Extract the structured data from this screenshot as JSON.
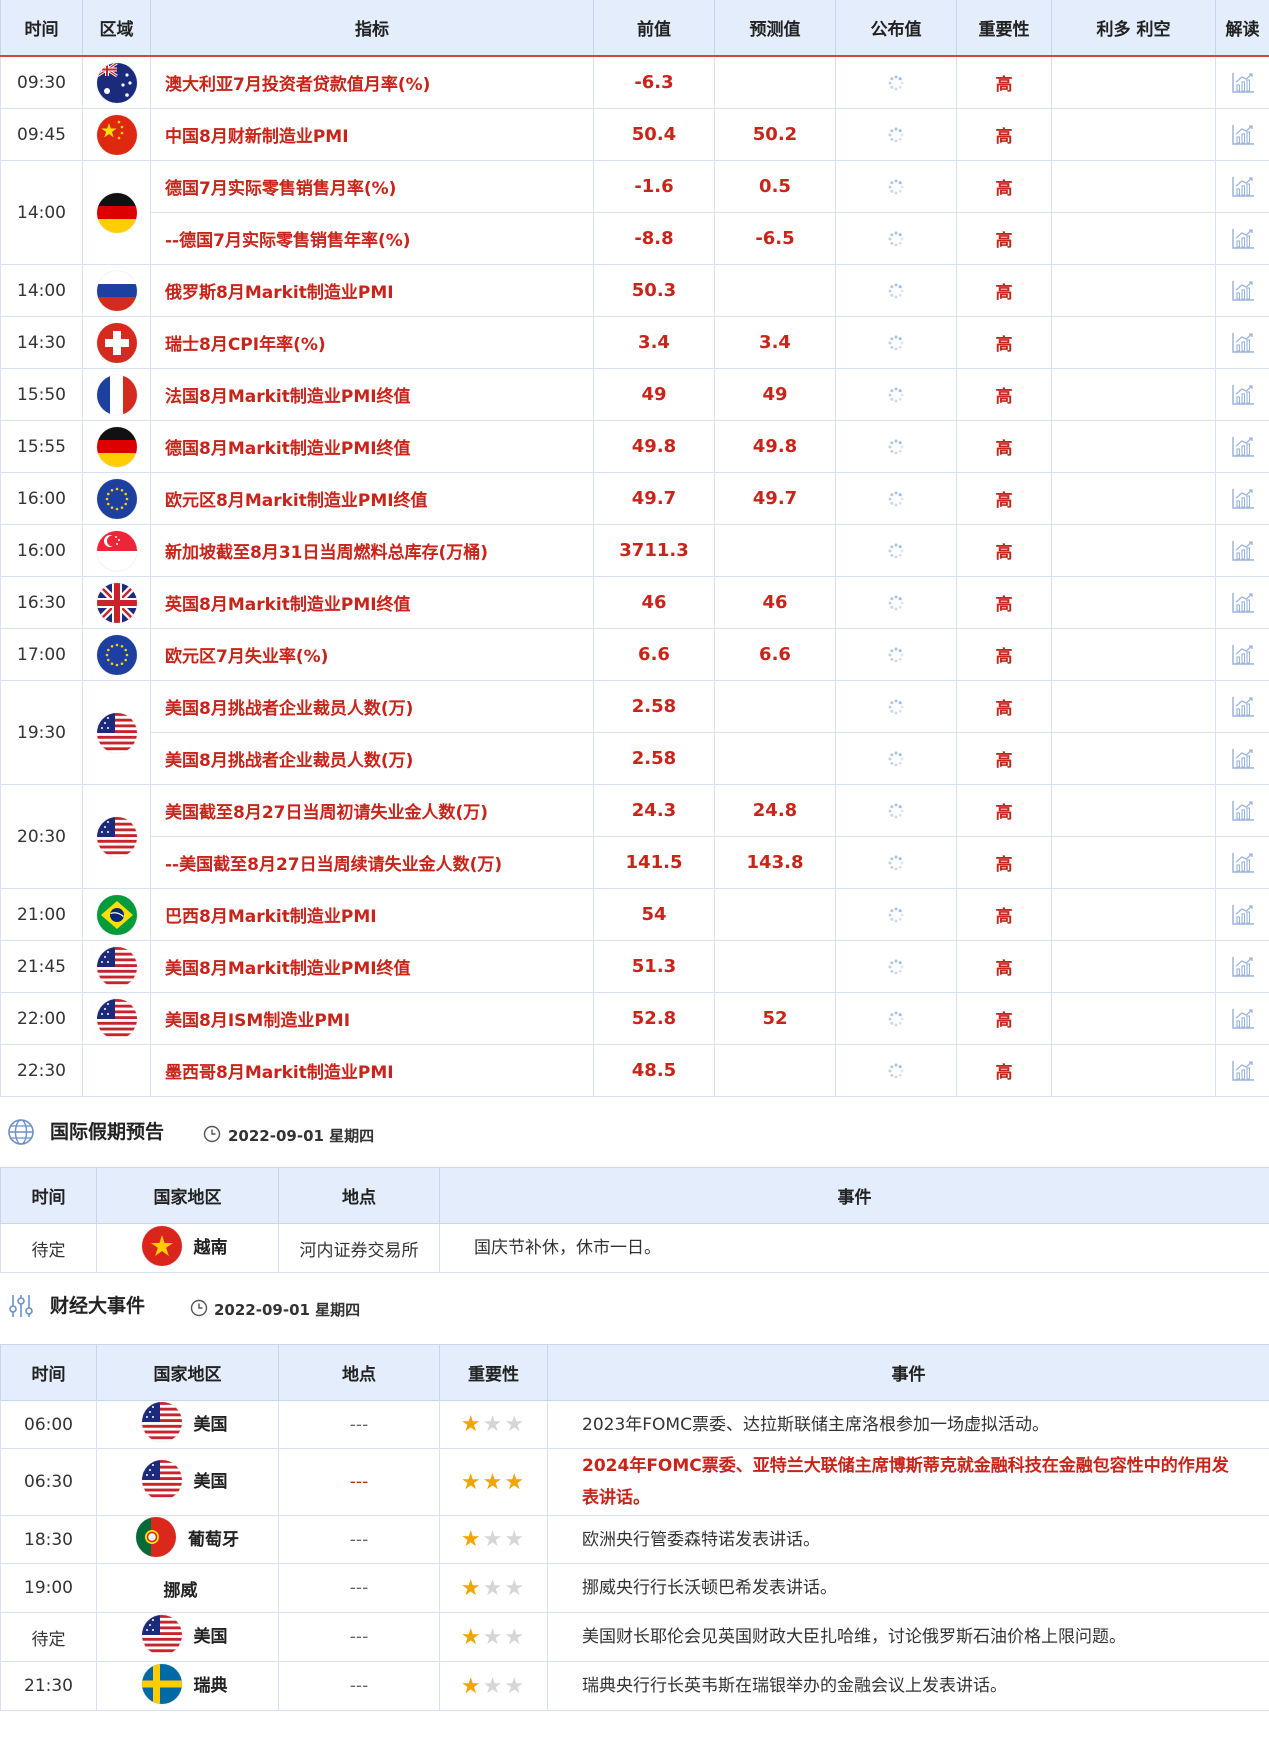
{
  "econ_table": {
    "headers": [
      "时间",
      "区域",
      "指标",
      "前值",
      "预测值",
      "公布值",
      "重要性",
      "利多 利空",
      "解读"
    ],
    "rows": [
      {
        "time": "09:30",
        "flag": "au",
        "name": "澳大利亚7月投资者贷款值月率(%)",
        "prev": "-6.3",
        "forecast": "",
        "imp": "高"
      },
      {
        "time": "09:45",
        "flag": "cn",
        "name": "中国8月财新制造业PMI",
        "prev": "50.4",
        "forecast": "50.2",
        "imp": "高"
      },
      {
        "time": "14:00",
        "flag": "de",
        "rowspan": 2,
        "name": "德国7月实际零售销售月率(%)",
        "prev": "-1.6",
        "forecast": "0.5",
        "imp": "高"
      },
      {
        "time": "",
        "flag": "",
        "name": "--德国7月实际零售销售年率(%)",
        "prev": "-8.8",
        "forecast": "-6.5",
        "imp": "高",
        "cont": true
      },
      {
        "time": "14:00",
        "flag": "ru",
        "name": "俄罗斯8月Markit制造业PMI",
        "prev": "50.3",
        "forecast": "",
        "imp": "高"
      },
      {
        "time": "14:30",
        "flag": "ch",
        "name": "瑞士8月CPI年率(%)",
        "prev": "3.4",
        "forecast": "3.4",
        "imp": "高"
      },
      {
        "time": "15:50",
        "flag": "fr",
        "name": "法国8月Markit制造业PMI终值",
        "prev": "49",
        "forecast": "49",
        "imp": "高"
      },
      {
        "time": "15:55",
        "flag": "de",
        "name": "德国8月Markit制造业PMI终值",
        "prev": "49.8",
        "forecast": "49.8",
        "imp": "高"
      },
      {
        "time": "16:00",
        "flag": "eu",
        "name": "欧元区8月Markit制造业PMI终值",
        "prev": "49.7",
        "forecast": "49.7",
        "imp": "高"
      },
      {
        "time": "16:00",
        "flag": "sg",
        "name": "新加坡截至8月31日当周燃料总库存(万桶)",
        "prev": "3711.3",
        "forecast": "",
        "imp": "高"
      },
      {
        "time": "16:30",
        "flag": "gb",
        "name": "英国8月Markit制造业PMI终值",
        "prev": "46",
        "forecast": "46",
        "imp": "高"
      },
      {
        "time": "17:00",
        "flag": "eu",
        "name": "欧元区7月失业率(%)",
        "prev": "6.6",
        "forecast": "6.6",
        "imp": "高"
      },
      {
        "time": "19:30",
        "flag": "us",
        "rowspan": 2,
        "name": "美国8月挑战者企业裁员人数(万)",
        "prev": "2.58",
        "forecast": "",
        "imp": "高"
      },
      {
        "time": "",
        "flag": "",
        "name": "美国8月挑战者企业裁员人数(万)",
        "prev": "2.58",
        "forecast": "",
        "imp": "高",
        "cont": true
      },
      {
        "time": "20:30",
        "flag": "us",
        "rowspan": 2,
        "name": "美国截至8月27日当周初请失业金人数(万)",
        "prev": "24.3",
        "forecast": "24.8",
        "imp": "高"
      },
      {
        "time": "",
        "flag": "",
        "name": "--美国截至8月27日当周续请失业金人数(万)",
        "prev": "141.5",
        "forecast": "143.8",
        "imp": "高",
        "cont": true
      },
      {
        "time": "21:00",
        "flag": "br",
        "name": "巴西8月Markit制造业PMI",
        "prev": "54",
        "forecast": "",
        "imp": "高"
      },
      {
        "time": "21:45",
        "flag": "us",
        "name": "美国8月Markit制造业PMI终值",
        "prev": "51.3",
        "forecast": "",
        "imp": "高"
      },
      {
        "time": "22:00",
        "flag": "us",
        "name": "美国8月ISM制造业PMI",
        "prev": "52.8",
        "forecast": "52",
        "imp": "高"
      },
      {
        "time": "22:30",
        "flag": "none",
        "name": "墨西哥8月Markit制造业PMI",
        "prev": "48.5",
        "forecast": "",
        "imp": "高"
      }
    ]
  },
  "holiday_section": {
    "title": "国际假期预告",
    "date": "2022-09-01 星期四",
    "headers": [
      "时间",
      "国家地区",
      "地点",
      "事件"
    ],
    "rows": [
      {
        "time": "待定",
        "flag": "vn",
        "country": "越南",
        "place": "河内证券交易所",
        "event": "国庆节补休，休市一日。"
      }
    ]
  },
  "events_section": {
    "title": "财经大事件",
    "date": "2022-09-01 星期四",
    "headers": [
      "时间",
      "国家地区",
      "地点",
      "重要性",
      "事件"
    ],
    "rows": [
      {
        "time": "06:00",
        "flag": "us",
        "country": "美国",
        "place": "---",
        "stars": 1,
        "event": "2023年FOMC票委、达拉斯联储主席洛根参加一场虚拟活动。",
        "hot": false
      },
      {
        "time": "06:30",
        "flag": "us",
        "country": "美国",
        "place": "---",
        "stars": 3,
        "event": "2024年FOMC票委、亚特兰大联储主席博斯蒂克就金融科技在金融包容性中的作用发表讲话。",
        "hot": true
      },
      {
        "time": "18:30",
        "flag": "pt",
        "country": "葡萄牙",
        "place": "---",
        "stars": 1,
        "event": "欧洲央行管委森特诺发表讲话。",
        "hot": false
      },
      {
        "time": "19:00",
        "flag": "none",
        "country": "挪威",
        "place": "---",
        "stars": 1,
        "event": "挪威央行行长沃顿巴希发表讲话。",
        "hot": false
      },
      {
        "time": "待定",
        "flag": "us",
        "country": "美国",
        "place": "---",
        "stars": 1,
        "event": "美国财长耶伦会见英国财政大臣扎哈维，讨论俄罗斯石油价格上限问题。",
        "hot": false
      },
      {
        "time": "21:30",
        "flag": "se",
        "country": "瑞典",
        "place": "---",
        "stars": 1,
        "event": "瑞典央行行长英韦斯在瑞银举办的金融会议上发表讲话。",
        "hot": false
      }
    ]
  },
  "icons": {
    "spinner": "loading-spinner-icon",
    "chart": "chart-analysis-icon",
    "globe": "globe-icon",
    "clock": "clock-icon",
    "finance": "finance-settings-icon"
  },
  "colors": {
    "accent": "#c8241a",
    "header_bg": "#e3edfb",
    "star": "#f0a500"
  }
}
